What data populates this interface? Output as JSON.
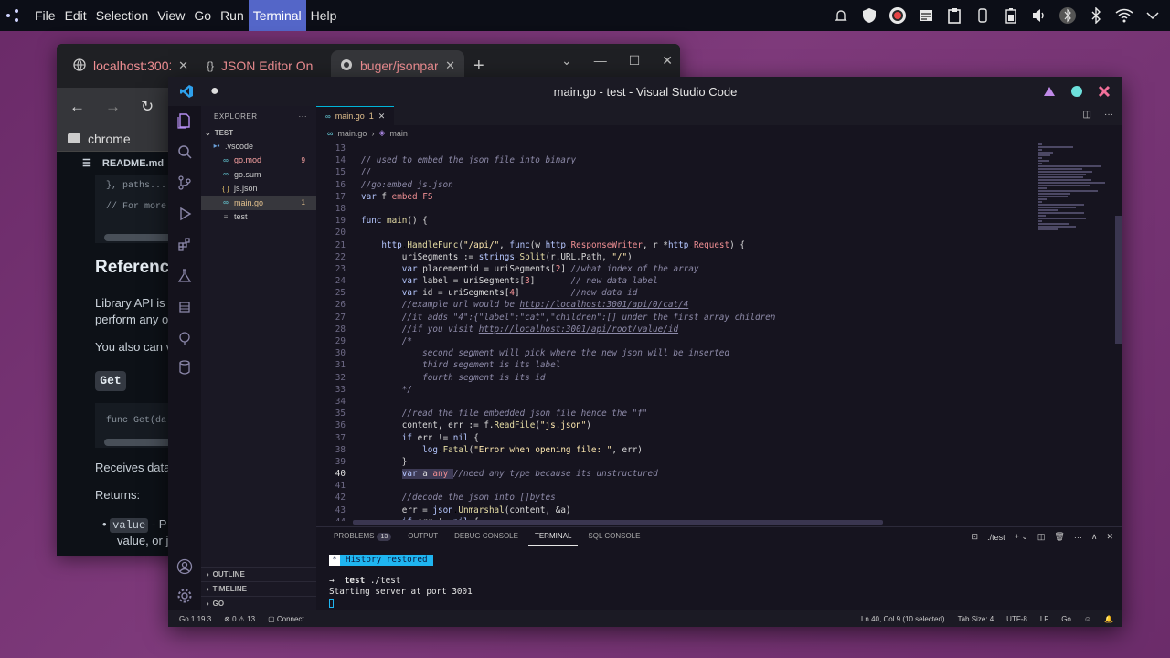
{
  "topbar": {
    "menus": [
      "File",
      "Edit",
      "Selection",
      "View",
      "Go",
      "Run",
      "Terminal",
      "Help"
    ],
    "active_menu": "Terminal",
    "tray_icons": [
      "alert-icon",
      "shield-icon",
      "obs-icon",
      "notes-icon",
      "clipboard-icon",
      "device-icon",
      "battery-icon",
      "volume-icon",
      "bluetooth-icon",
      "bluetooth-alt-icon",
      "wifi-icon",
      "chevron-down-icon"
    ]
  },
  "chrome": {
    "tabs": [
      {
        "label": "localhost:3001/",
        "icon": "globe-icon"
      },
      {
        "label": "JSON Editor On",
        "icon": "braces-icon"
      },
      {
        "label": "buger/jsonpars",
        "icon": "github-icon"
      }
    ],
    "bookmark": "chrome",
    "readme_title": "README.md",
    "code_top_1": "}, paths...",
    "code_top_2": "// For more",
    "heading_reference": "Referenc",
    "text_library_1": "Library API is r",
    "text_library_2": "perform any o",
    "text_also": "You also can v",
    "heading_get": "Get",
    "code_get": "func Get(da",
    "text_receives": "Receives data",
    "text_returns": "Returns:",
    "bullet_value_code": "value",
    "bullet_value_text": " - P",
    "bullet_value_text2": "value, or j"
  },
  "vscode": {
    "window_title": "main.go - test - Visual Studio Code",
    "explorer": {
      "title": "EXPLORER",
      "section": "TEST",
      "files": [
        {
          "name": ".vscode",
          "icon": "folder-icon",
          "color": "#cccccc",
          "badge": ""
        },
        {
          "name": "go.mod",
          "icon": "go-file-icon",
          "color": "#f7a0a0",
          "badge": "9"
        },
        {
          "name": "go.sum",
          "icon": "go-file-icon",
          "color": "#cccccc",
          "badge": ""
        },
        {
          "name": "js.json",
          "icon": "json-file-icon",
          "color": "#cccccc",
          "badge": ""
        },
        {
          "name": "main.go",
          "icon": "go-file-icon",
          "color": "#e2c08d",
          "badge": "1"
        },
        {
          "name": "test",
          "icon": "file-icon",
          "color": "#cccccc",
          "badge": ""
        }
      ],
      "outline": "OUTLINE",
      "timeline": "TIMELINE",
      "go": "GO"
    },
    "editor_tab": {
      "label": "main.go",
      "badge": "1"
    },
    "breadcrumb": [
      "main.go",
      "main"
    ],
    "cursor_line": "40",
    "code_lines": [
      {
        "n": "13",
        "html": ""
      },
      {
        "n": "14",
        "html": "<span class=\"c\">// used to embed the json file into binary</span>"
      },
      {
        "n": "15",
        "html": "<span class=\"c\">//</span>"
      },
      {
        "n": "16",
        "html": "<span class=\"c\">//go:embed js.json</span>"
      },
      {
        "n": "17",
        "html": "<span class=\"k\">var</span> <span class=\"v\">f</span> <span class=\"t\">embed</span>.<span class=\"t\">FS</span>"
      },
      {
        "n": "18",
        "html": ""
      },
      {
        "n": "19",
        "html": "<span class=\"k\">func</span> <span class=\"f\">main</span><span class=\"v\">() {</span>"
      },
      {
        "n": "20",
        "html": ""
      },
      {
        "n": "21",
        "html": "    <span class=\"k\">http</span>.<span class=\"f\">HandleFunc</span><span class=\"v\">(</span><span class=\"s\">\"/api/\"</span><span class=\"v\">, </span><span class=\"k\">func</span><span class=\"v\">(w </span><span class=\"k\">http</span>.<span class=\"t\">ResponseWriter</span><span class=\"v\">, r *</span><span class=\"k\">http</span>.<span class=\"t\">Request</span><span class=\"v\">) {</span>"
      },
      {
        "n": "22",
        "html": "        <span class=\"v\">uriSegments := </span><span class=\"k\">strings</span>.<span class=\"f\">Split</span><span class=\"v\">(r.URL.Path, </span><span class=\"s\">\"/\"</span><span class=\"v\">)</span>"
      },
      {
        "n": "23",
        "html": "        <span class=\"k\">var</span> <span class=\"v\">placementid = uriSegments[</span><span class=\"t\">2</span><span class=\"v\">]</span> <span class=\"c\">//what index of the array</span>"
      },
      {
        "n": "24",
        "html": "        <span class=\"k\">var</span> <span class=\"v\">label = uriSegments[</span><span class=\"t\">3</span><span class=\"v\">]</span>       <span class=\"c\">// new data label</span>"
      },
      {
        "n": "25",
        "html": "        <span class=\"k\">var</span> <span class=\"v\">id = uriSegments[</span><span class=\"t\">4</span><span class=\"v\">]</span>          <span class=\"c\">//new data id</span>"
      },
      {
        "n": "26",
        "html": "        <span class=\"c\">//example url would be </span><span class=\"u\">http://localhost:3001/api/0/cat/4</span>"
      },
      {
        "n": "27",
        "html": "        <span class=\"c\">//it adds \"4\":{\"label\":\"cat\",\"children\":[] under the first array children</span>"
      },
      {
        "n": "28",
        "html": "        <span class=\"c\">//if you visit </span><span class=\"u\">http://localhost:3001/api/root/value/id</span>"
      },
      {
        "n": "29",
        "html": "        <span class=\"c\">/*</span>"
      },
      {
        "n": "30",
        "html": "            <span class=\"c\">second segment will pick where the new json will be inserted</span>"
      },
      {
        "n": "31",
        "html": "            <span class=\"c\">third segement is its label</span>"
      },
      {
        "n": "32",
        "html": "            <span class=\"c\">fourth segment is its id</span>"
      },
      {
        "n": "33",
        "html": "        <span class=\"c\">*/</span>"
      },
      {
        "n": "34",
        "html": ""
      },
      {
        "n": "35",
        "html": "        <span class=\"c\">//read the file embedded json file hence the \"f\"</span>"
      },
      {
        "n": "36",
        "html": "        <span class=\"v\">content, err := f.</span><span class=\"f\">ReadFile</span><span class=\"v\">(</span><span class=\"s\">\"js.json\"</span><span class=\"v\">)</span>"
      },
      {
        "n": "37",
        "html": "        <span class=\"k\">if</span> <span class=\"v\">err != </span><span class=\"k\">nil</span> <span class=\"v\">{</span>"
      },
      {
        "n": "38",
        "html": "            <span class=\"k\">log</span>.<span class=\"f\">Fatal</span><span class=\"v\">(</span><span class=\"s\">\"Error when opening file: \"</span><span class=\"v\">, err)</span>"
      },
      {
        "n": "39",
        "html": "        <span class=\"v\">}</span>"
      },
      {
        "n": "40",
        "html": "        <span class=\"sel\"><span class=\"k\">var</span> <span class=\"v\">a</span> <span class=\"t\">any</span> </span><span class=\"c\">//need any type because its unstructured</span>"
      },
      {
        "n": "41",
        "html": ""
      },
      {
        "n": "42",
        "html": "        <span class=\"c\">//decode the json into []bytes</span>"
      },
      {
        "n": "43",
        "html": "        <span class=\"v\">err = </span><span class=\"k\">json</span>.<span class=\"f\">Unmarshal</span><span class=\"v\">(content, &amp;a)</span>"
      },
      {
        "n": "44",
        "html": "        <span class=\"k\">if</span> <span class=\"v\">err != </span><span class=\"k\">nil</span> <span class=\"v\">{</span>"
      }
    ],
    "panel_tabs": [
      {
        "label": "PROBLEMS",
        "badge": "13"
      },
      {
        "label": "OUTPUT",
        "badge": ""
      },
      {
        "label": "DEBUG CONSOLE",
        "badge": ""
      },
      {
        "label": "TERMINAL",
        "badge": ""
      },
      {
        "label": "SQL CONSOLE",
        "badge": ""
      }
    ],
    "active_panel_tab": "TERMINAL",
    "terminal_name": "./test",
    "terminal": {
      "history_label": "History restored",
      "prompt_arrow": "→",
      "prompt_dir": "test",
      "command": "./test",
      "output": "Starting server at port 3001"
    },
    "status": {
      "go_version": "Go 1.19.3",
      "errors": "0",
      "warnings": "13",
      "connect": "Connect",
      "position": "Ln 40, Col 9 (10 selected)",
      "tab_size": "Tab Size: 4",
      "encoding": "UTF-8",
      "eol": "LF",
      "language": "Go"
    },
    "colors": {
      "accent": "#00b4d8",
      "selection_bg": "#3d3a55"
    }
  }
}
